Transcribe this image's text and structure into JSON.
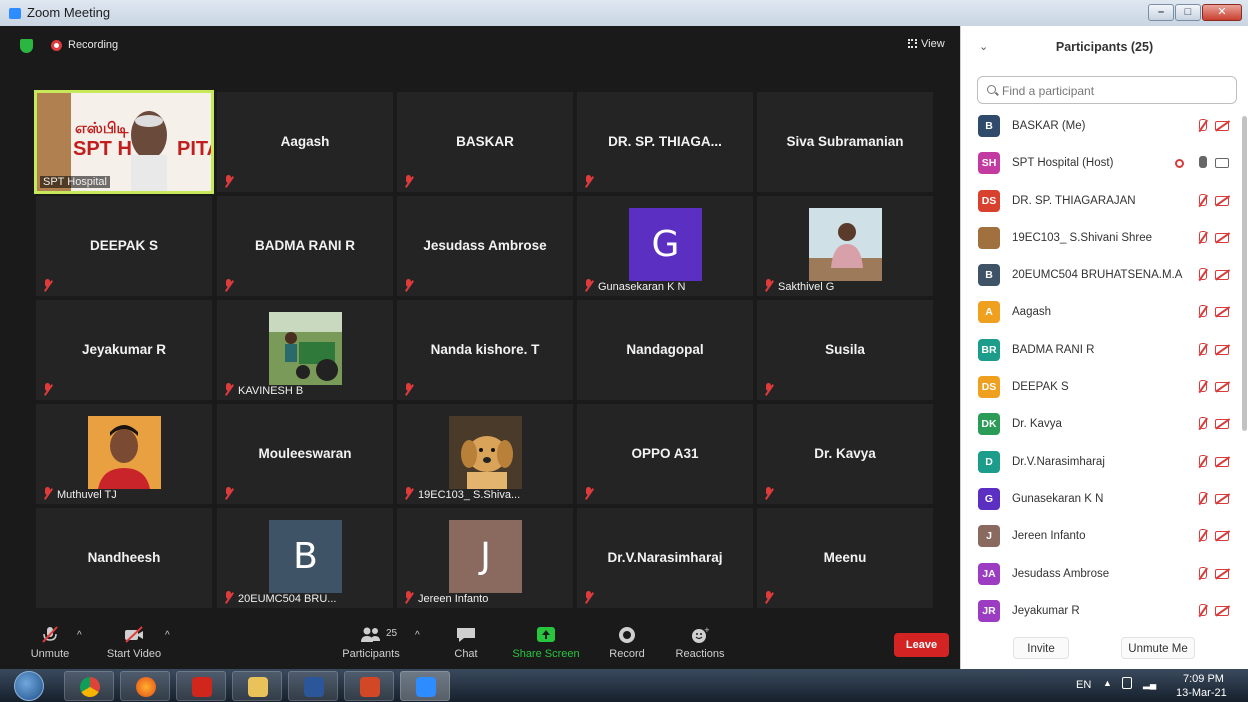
{
  "window": {
    "title": "Zoom Meeting"
  },
  "meeting": {
    "recording_label": "Recording",
    "view_label": "View",
    "tiles": [
      {
        "kind": "video-host",
        "name": "",
        "label": "SPT Hospital",
        "muted": false
      },
      {
        "kind": "name",
        "name": "Aagash",
        "label": "",
        "muted": true
      },
      {
        "kind": "name",
        "name": "BASKAR",
        "label": "",
        "muted": true
      },
      {
        "kind": "name",
        "name": "DR. SP. THIAGA...",
        "label": "",
        "muted": true
      },
      {
        "kind": "name",
        "name": "Siva Subramanian",
        "label": "",
        "muted": false
      },
      {
        "kind": "name",
        "name": "DEEPAK S",
        "label": "",
        "muted": true
      },
      {
        "kind": "name",
        "name": "BADMA RANI R",
        "label": "",
        "muted": true
      },
      {
        "kind": "name",
        "name": "Jesudass Ambrose",
        "label": "",
        "muted": true
      },
      {
        "kind": "avatar",
        "name": "",
        "initial": "G",
        "color": "#5b2fc2",
        "label": "Gunasekaran K N",
        "muted": true
      },
      {
        "kind": "photo",
        "name": "",
        "photo": "man",
        "label": "Sakthivel G",
        "muted": true
      },
      {
        "kind": "name",
        "name": "Jeyakumar R",
        "label": "",
        "muted": true
      },
      {
        "kind": "photo",
        "name": "",
        "photo": "tractor",
        "label": "KAVINESH B",
        "muted": true
      },
      {
        "kind": "name",
        "name": "Nanda kishore. T",
        "label": "",
        "muted": true
      },
      {
        "kind": "name",
        "name": "Nandagopal",
        "label": "",
        "muted": false
      },
      {
        "kind": "name",
        "name": "Susila",
        "label": "",
        "muted": true
      },
      {
        "kind": "photo",
        "name": "",
        "photo": "selfie",
        "label": "Muthuvel TJ",
        "muted": true
      },
      {
        "kind": "name",
        "name": "Mouleeswaran",
        "label": "",
        "muted": true
      },
      {
        "kind": "photo",
        "name": "",
        "photo": "dog",
        "label": "19EC103_ S.Shiva...",
        "muted": true
      },
      {
        "kind": "name",
        "name": "OPPO A31",
        "label": "",
        "muted": true
      },
      {
        "kind": "name",
        "name": "Dr. Kavya",
        "label": "",
        "muted": true
      },
      {
        "kind": "name",
        "name": "Nandheesh",
        "label": "",
        "muted": false
      },
      {
        "kind": "avatar",
        "name": "",
        "initial": "B",
        "color": "#3e5466",
        "label": "20EUMC504 BRU...",
        "muted": true
      },
      {
        "kind": "avatar",
        "name": "",
        "initial": "J",
        "color": "#8a6a5e",
        "label": "Jereen Infanto",
        "muted": true
      },
      {
        "kind": "name",
        "name": "Dr.V.Narasimharaj",
        "label": "",
        "muted": true
      },
      {
        "kind": "name",
        "name": "Meenu",
        "label": "",
        "muted": true
      }
    ]
  },
  "toolbar": {
    "unmute": "Unmute",
    "start_video": "Start Video",
    "participants": "Participants",
    "participants_count": "25",
    "chat": "Chat",
    "share_screen": "Share Screen",
    "record": "Record",
    "reactions": "Reactions",
    "leave": "Leave"
  },
  "panel": {
    "title": "Participants (25)",
    "search_placeholder": "Find a participant",
    "participants": [
      {
        "initials": "B",
        "color": "#2f4a6b",
        "name": "BASKAR (Me)",
        "mic": "muted",
        "cam": "off",
        "rec": false
      },
      {
        "initials": "SH",
        "color": "#c33ba0",
        "name": "SPT Hospital (Host)",
        "mic": "on",
        "cam": "on",
        "rec": true
      },
      {
        "initials": "DS",
        "color": "#d9412f",
        "name": "DR. SP. THIAGARAJAN",
        "mic": "muted",
        "cam": "off",
        "rec": false
      },
      {
        "initials": "",
        "color": "#a0703f",
        "name": "19EC103_ S.Shivani Shree",
        "mic": "muted",
        "cam": "off",
        "rec": false
      },
      {
        "initials": "B",
        "color": "#3e5466",
        "name": "20EUMC504 BRUHATSENA.M.A",
        "mic": "muted",
        "cam": "off",
        "rec": false
      },
      {
        "initials": "A",
        "color": "#f0a01f",
        "name": "Aagash",
        "mic": "muted",
        "cam": "off",
        "rec": false
      },
      {
        "initials": "BR",
        "color": "#1c9c8a",
        "name": "BADMA RANI R",
        "mic": "muted",
        "cam": "off",
        "rec": false
      },
      {
        "initials": "DS",
        "color": "#f0a01f",
        "name": "DEEPAK S",
        "mic": "muted",
        "cam": "off",
        "rec": false
      },
      {
        "initials": "DK",
        "color": "#2b9c57",
        "name": "Dr. Kavya",
        "mic": "muted",
        "cam": "off",
        "rec": false
      },
      {
        "initials": "D",
        "color": "#1c9c8a",
        "name": "Dr.V.Narasimharaj",
        "mic": "muted",
        "cam": "off",
        "rec": false
      },
      {
        "initials": "G",
        "color": "#5b2fc2",
        "name": "Gunasekaran K N",
        "mic": "muted",
        "cam": "off",
        "rec": false
      },
      {
        "initials": "J",
        "color": "#8a6a5e",
        "name": "Jereen Infanto",
        "mic": "muted",
        "cam": "off",
        "rec": false
      },
      {
        "initials": "JA",
        "color": "#9b3cc2",
        "name": "Jesudass Ambrose",
        "mic": "muted",
        "cam": "off",
        "rec": false
      },
      {
        "initials": "JR",
        "color": "#9b3cc2",
        "name": "Jeyakumar R",
        "mic": "muted",
        "cam": "off",
        "rec": false
      }
    ],
    "invite": "Invite",
    "unmute_me": "Unmute Me"
  },
  "taskbar": {
    "lang": "EN",
    "time": "7:09 PM",
    "date": "13-Mar-21"
  }
}
